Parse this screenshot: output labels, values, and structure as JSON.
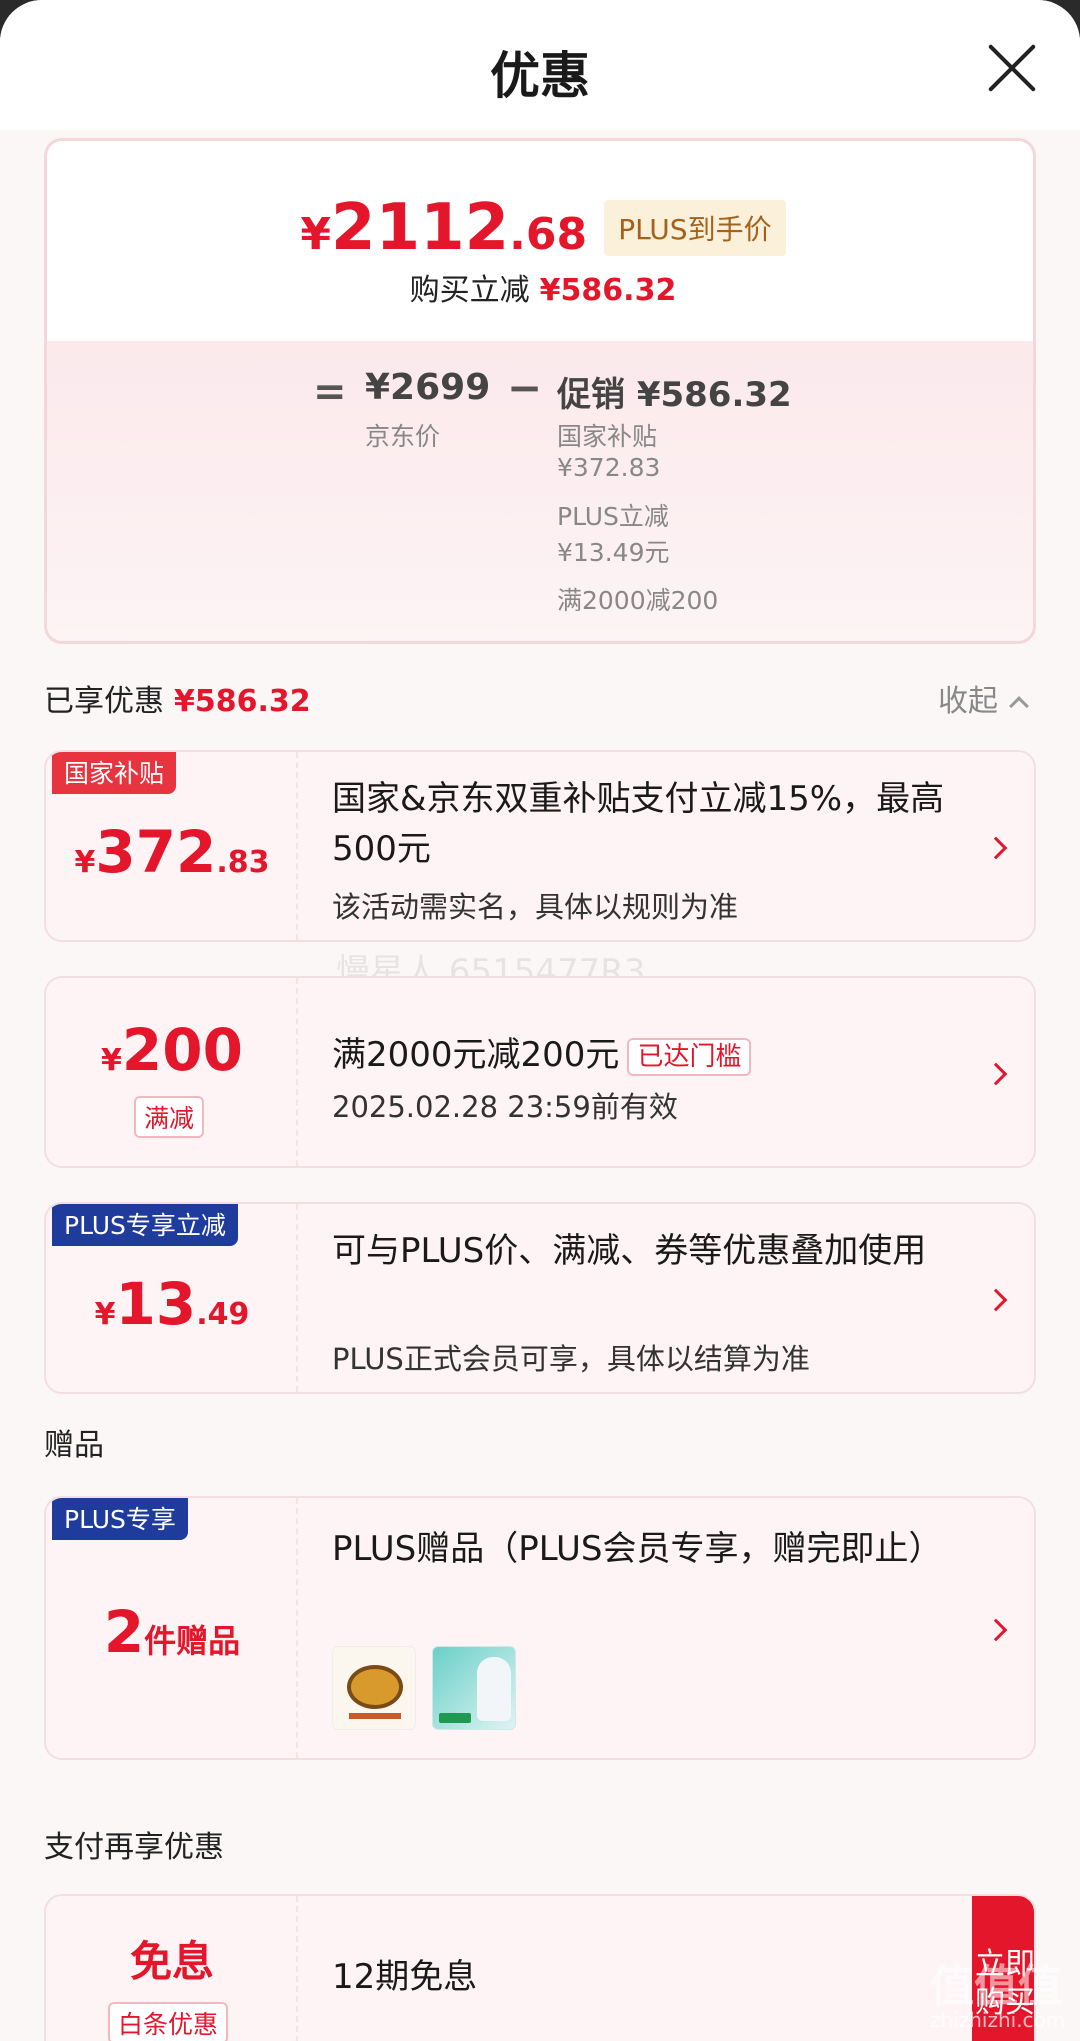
{
  "header": {
    "title": "优惠"
  },
  "summary": {
    "final_price": {
      "currency": "¥",
      "integer": "2112",
      "decimal": ".68"
    },
    "plus_badge": "PLUS到手价",
    "reduce_label": "购买立减",
    "reduce_amount": "¥586.32",
    "equals": "=",
    "jd_price": "¥2699",
    "jd_label": "京东价",
    "minus": "−",
    "promo_head": "促销 ¥586.32",
    "promo_lines": [
      "国家补贴",
      "¥372.83",
      "PLUS立减",
      "¥13.49元",
      "满2000减200"
    ]
  },
  "enjoyed": {
    "label": "已享优惠",
    "amount": "¥586.32",
    "collapse": "收起"
  },
  "discounts": [
    {
      "tag": "国家补贴",
      "currency": "¥",
      "integer": "372",
      "decimal": ".83",
      "title": "国家&京东双重补贴支付立减15%，最高500元",
      "sub": "该活动需实名，具体以规则为准"
    },
    {
      "currency": "¥",
      "integer": "200",
      "small_tag": "满减",
      "title": "满2000元减200元",
      "met": "已达门槛",
      "sub": "2025.02.28 23:59前有效"
    },
    {
      "tag": "PLUS专享立减",
      "currency": "¥",
      "integer": "13",
      "decimal": ".49",
      "title": "可与PLUS价、满减、券等优惠叠加使用",
      "sub": "PLUS正式会员可享，具体以结算为准"
    }
  ],
  "gifts": {
    "label": "赠品",
    "tag": "PLUS专享",
    "count": "2",
    "count_unit": "件赠品",
    "title": "PLUS赠品（PLUS会员专享，赠完即止）"
  },
  "payment": {
    "label": "支付再享优惠",
    "name": "免息",
    "sub_tag": "白条优惠",
    "title": "12期免息",
    "button": "立即购买"
  },
  "watermark": "慢星人.6515477R3",
  "corner_watermark": {
    "brand": "值值值",
    "site": "zhizhizhi.com"
  }
}
